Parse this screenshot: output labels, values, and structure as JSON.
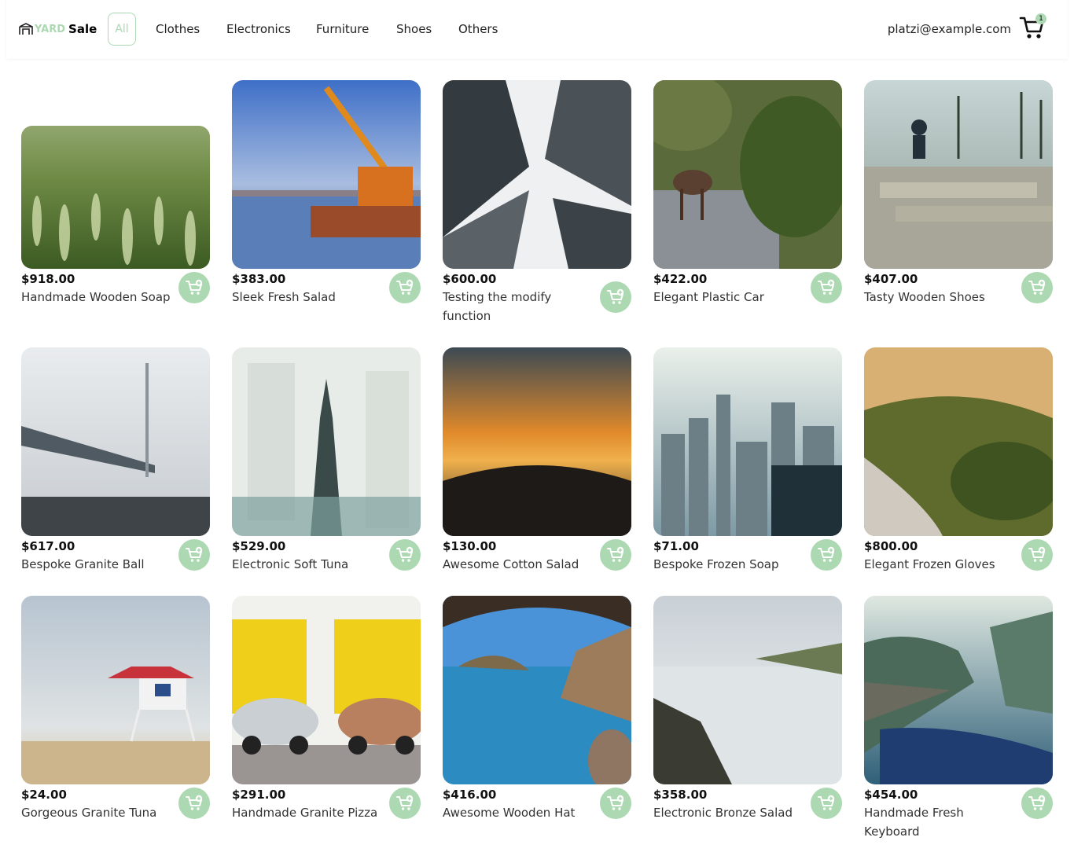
{
  "brand": {
    "yard": "YARD",
    "sale": "Sale"
  },
  "nav": {
    "all": "All",
    "categories": [
      "Clothes",
      "Electronics",
      "Furniture",
      "Shoes",
      "Others"
    ]
  },
  "user": {
    "email": "platzi@example.com"
  },
  "cart": {
    "count": "1"
  },
  "colors": {
    "accent": "#acd9b2",
    "text": "#000000"
  },
  "products": [
    {
      "price": "$918.00",
      "name": "Handmade Wooden Soap",
      "image": "wheat-field"
    },
    {
      "price": "$383.00",
      "name": "Sleek Fresh Salad",
      "image": "harbor-crane"
    },
    {
      "price": "$600.00",
      "name": "Testing the modify function",
      "image": "skyscrapers-up"
    },
    {
      "price": "$422.00",
      "name": "Elegant Plastic Car",
      "image": "moose-river"
    },
    {
      "price": "$407.00",
      "name": "Tasty Wooden Shoes",
      "image": "skatepark"
    },
    {
      "price": "$617.00",
      "name": "Bespoke Granite Ball",
      "image": "foggy-bridge"
    },
    {
      "price": "$529.00",
      "name": "Electronic Soft Tuna",
      "image": "empire-state-blur"
    },
    {
      "price": "$130.00",
      "name": "Awesome Cotton Salad",
      "image": "sunset-hill"
    },
    {
      "price": "$71.00",
      "name": "Bespoke Frozen Soap",
      "image": "city-skyline"
    },
    {
      "price": "$800.00",
      "name": "Elegant Frozen Gloves",
      "image": "forest-cliff"
    },
    {
      "price": "$24.00",
      "name": "Gorgeous Granite Tuna",
      "image": "lifeguard-tower"
    },
    {
      "price": "$291.00",
      "name": "Handmade Granite Pizza",
      "image": "vintage-cars"
    },
    {
      "price": "$416.00",
      "name": "Awesome Wooden Hat",
      "image": "sea-cave"
    },
    {
      "price": "$358.00",
      "name": "Electronic Bronze Salad",
      "image": "waterfall"
    },
    {
      "price": "$454.00",
      "name": "Handmade Fresh Keyboard",
      "image": "fjord-cliff"
    }
  ]
}
